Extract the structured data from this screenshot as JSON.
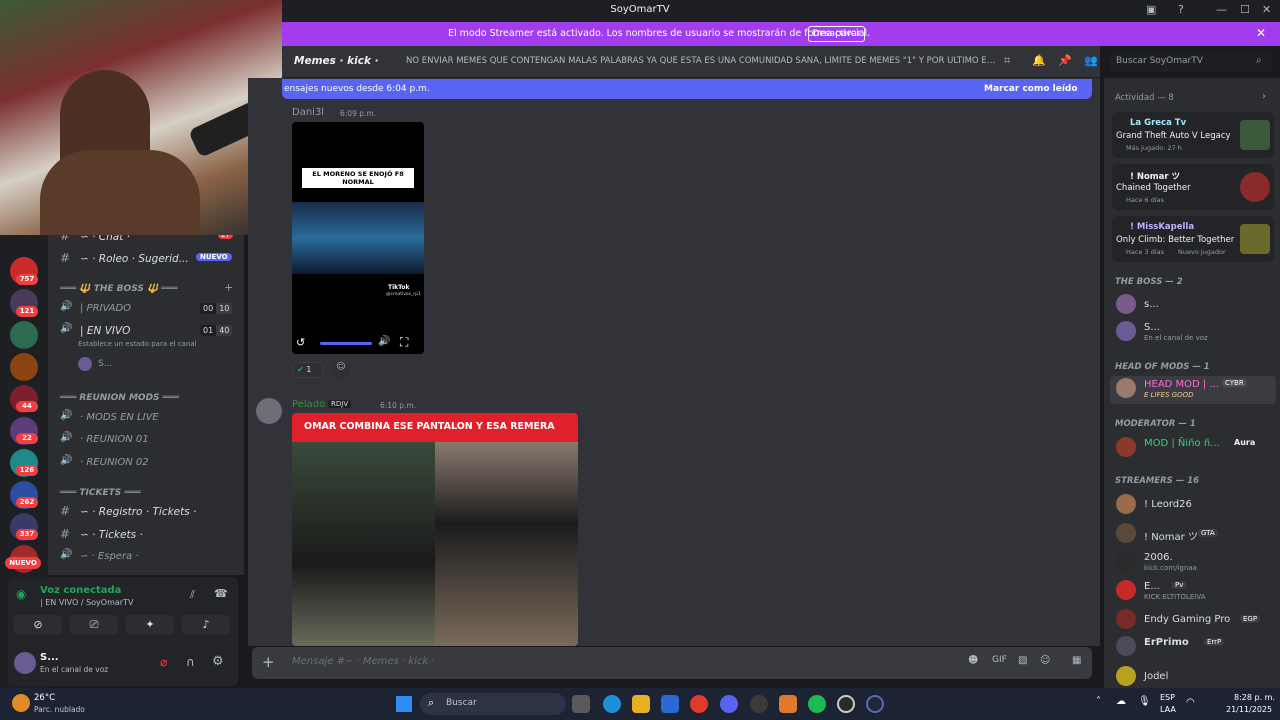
{
  "window": {
    "title": "SoyOmarTV"
  },
  "banner": {
    "text": "El modo Streamer está activado. Los nombres de usuario se mostrarán de forma parcial.",
    "button": "Desactivar"
  },
  "servers": {
    "badges": [
      "757",
      "121",
      "44",
      "22",
      "126",
      "262",
      "337"
    ],
    "new_label": "NUEVO"
  },
  "channels": {
    "chat": {
      "name": "∽ · Chat ·",
      "badge": "27"
    },
    "roleo": {
      "name": "∽ · Roleo · Sugerid...",
      "badge": "NUEVO"
    },
    "cat_boss": "═══ 🔱 THE BOSS 🔱 ═══",
    "privado": {
      "name": "| PRIVADO",
      "count_a": "00",
      "count_b": "10"
    },
    "en_vivo": {
      "name": "| EN VIVO",
      "count_a": "01",
      "count_b": "40",
      "status_hint": "Establece un estado para el canal"
    },
    "voice_user": "S...",
    "cat_reunion": "═══ REUNION MODS ═══",
    "mods_live": "· MODS EN LIVE",
    "reunion1": "· REUNION 01",
    "reunion2": "· REUNION 02",
    "cat_tickets": "═══ TICKETS ═══",
    "registro": "∽ · Registro · Tickets ·",
    "tickets": "∽ · Tickets ·",
    "espera": "∽ · Espera ·"
  },
  "voice": {
    "status": "Voz conectada",
    "channel": "| EN VIVO / SoyOmarTV"
  },
  "user": {
    "name": "S...",
    "status": "En el canal de voz"
  },
  "header": {
    "channel": "Memes · kick ·",
    "topic": "NO ENVIAR MEMES QUE CONTENGAN MALAS PALABRAS YA QUE ESTA ES UNA COMUNIDAD SANA, LIMITE DE MEMES \"1\" Y POR ULTIMO EL ..."
  },
  "search": {
    "placeholder": "Buscar SoyOmarTV"
  },
  "new_messages": {
    "text": "ensajes nuevos desde 6:04 p.m.",
    "action": "Marcar como leído"
  },
  "messages": [
    {
      "author": "Dani3l",
      "time": "6:09 p.m.",
      "video_caption": "EL MORENO SE ENOJÓ F8 NORMAL",
      "watermark": "TikTok",
      "handle": "@creativos_rp1",
      "reaction_count": "1"
    },
    {
      "author": "Pelado",
      "tag": "RDJV",
      "time": "6:10 p.m.",
      "image_caption": "OMAR COMBINA ESE PANTALON Y ESA REMERA"
    }
  ],
  "composer": {
    "placeholder": "Mensaje #∽ · Memes · kick ·"
  },
  "members": {
    "activity_header": "Actividad — 8",
    "activities": [
      {
        "user": "La Greca Tv",
        "game": "Grand Theft Auto V Legacy",
        "meta": "Más jugado: 27 h"
      },
      {
        "user": "! Nomar ツ",
        "game": "Chained Together",
        "meta": "Hace 6 días"
      },
      {
        "user": "! MissKapella",
        "game": "Only Climb: Better Together",
        "meta": "Hace 3 días",
        "meta2": "Nuevo jugador"
      }
    ],
    "boss_header": "THE BOSS — 2",
    "boss": [
      {
        "name": "s...",
        "sub": ""
      },
      {
        "name": "S...",
        "sub": "En el canal de voz"
      }
    ],
    "head_header": "HEAD OF MODS — 1",
    "head": {
      "name": "HEAD MOD | ...",
      "tag": "CYBR",
      "sub": "E LIFES GOOD"
    },
    "mod_header": "MODERATOR — 1",
    "mod": {
      "name": "MOD | Ñiño ñ...",
      "tag": "Aura"
    },
    "streamers_header": "STREAMERS — 16",
    "streamers": [
      {
        "name": "! Leord26",
        "tag": "",
        "sub": ""
      },
      {
        "name": "! Nomar ツ",
        "tag": "GTA",
        "sub": ""
      },
      {
        "name": "2006.",
        "tag": "",
        "sub": "kick.com/ignaa"
      },
      {
        "name": "E...",
        "tag": "Pv",
        "sub": "KICK:ELTITOLEIVA"
      },
      {
        "name": "Endy Gaming Pro",
        "tag": "EGP",
        "sub": ""
      },
      {
        "name": "ErPrimo",
        "tag": "ErrP",
        "sub": ""
      },
      {
        "name": "Jodel",
        "tag": "",
        "sub": ""
      }
    ]
  },
  "taskbar": {
    "weather_temp": "26°C",
    "weather_desc": "Parc. nublado",
    "search": "Buscar",
    "lang": "ESP",
    "lang2": "LAA",
    "time": "8:28 p. m.",
    "date": "21/11/2025"
  }
}
